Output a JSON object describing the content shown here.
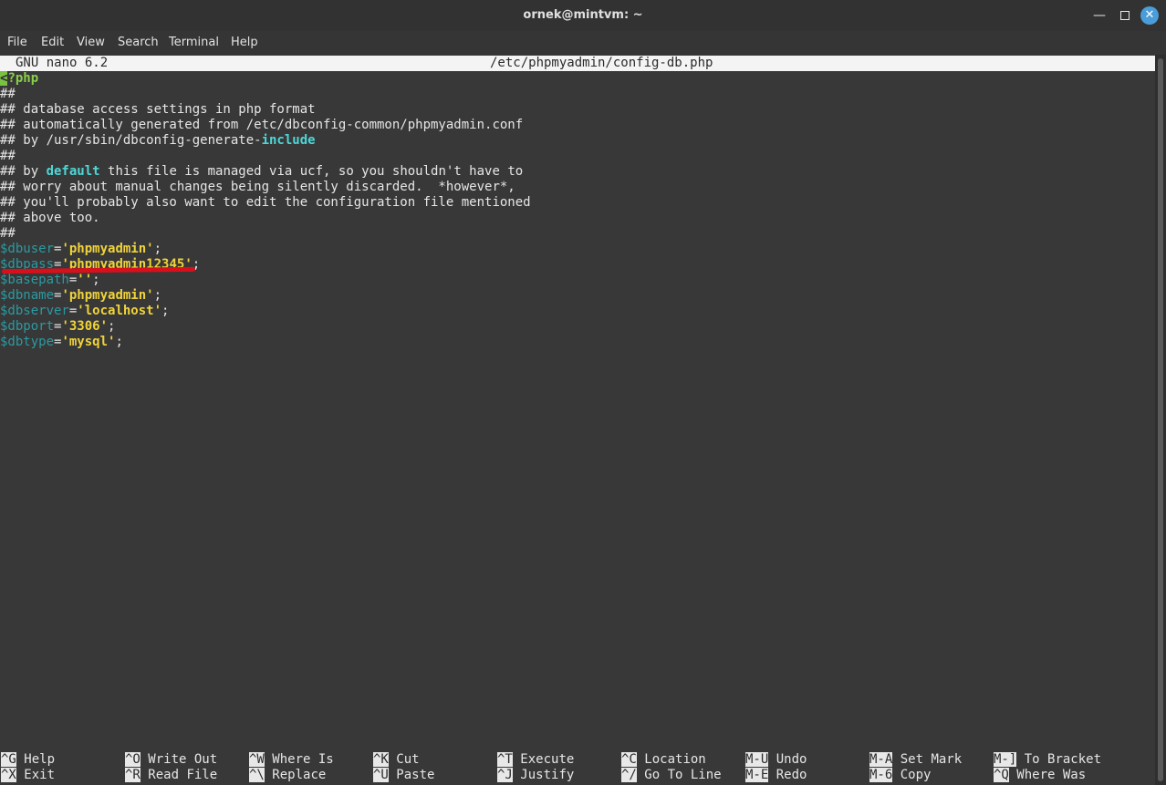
{
  "window": {
    "title": "ornek@mintvm: ~"
  },
  "menu": [
    "File",
    "Edit",
    "View",
    "Search",
    "Terminal",
    "Help"
  ],
  "nano": {
    "version": "GNU nano 6.2",
    "filename": "/etc/phpmyadmin/config-db.php"
  },
  "code": {
    "open_tag_cursor": "<",
    "open_tag_rest": "?php",
    "c1": "##",
    "c2": "## database access settings in php format",
    "c3": "## automatically generated from /etc/dbconfig-common/phpmyadmin.conf",
    "c4_pre": "## by /usr/sbin/dbconfig-generate-",
    "c4_kw": "include",
    "c5": "##",
    "c6_pre": "## by ",
    "c6_kw": "default",
    "c6_post": " this file is managed via ucf, so you shouldn't have to",
    "c7": "## worry about manual changes being silently discarded.  *however*,",
    "c8": "## you'll probably also want to edit the configuration file mentioned",
    "c9": "## above too.",
    "c10": "##",
    "vars": [
      {
        "name": "$dbuser",
        "value": "'phpmyadmin'"
      },
      {
        "name": "$dbpass",
        "value": "'phpmyadmin12345'"
      },
      {
        "name": "$basepath",
        "value": "''"
      },
      {
        "name": "$dbname",
        "value": "'phpmyadmin'"
      },
      {
        "name": "$dbserver",
        "value": "'localhost'"
      },
      {
        "name": "$dbport",
        "value": "'3306'"
      },
      {
        "name": "$dbtype",
        "value": "'mysql'"
      }
    ],
    "eq": "=",
    "semi": ";"
  },
  "shortcuts": {
    "row1": [
      {
        "key": "^G",
        "label": "Help"
      },
      {
        "key": "^O",
        "label": "Write Out"
      },
      {
        "key": "^W",
        "label": "Where Is"
      },
      {
        "key": "^K",
        "label": "Cut"
      },
      {
        "key": "^T",
        "label": "Execute"
      },
      {
        "key": "^C",
        "label": "Location"
      },
      {
        "key": "M-U",
        "label": "Undo"
      },
      {
        "key": "M-A",
        "label": "Set Mark"
      },
      {
        "key": "M-]",
        "label": "To Bracket"
      }
    ],
    "row2": [
      {
        "key": "^X",
        "label": "Exit"
      },
      {
        "key": "^R",
        "label": "Read File"
      },
      {
        "key": "^\\",
        "label": "Replace"
      },
      {
        "key": "^U",
        "label": "Paste"
      },
      {
        "key": "^J",
        "label": "Justify"
      },
      {
        "key": "^/",
        "label": "Go To Line"
      },
      {
        "key": "M-E",
        "label": "Redo"
      },
      {
        "key": "M-6",
        "label": "Copy"
      },
      {
        "key": "^Q",
        "label": "Where Was"
      }
    ]
  },
  "colors": {
    "header_bg": "#f4f4f4",
    "keyword": "#4fd6d6",
    "variable": "#2a9aa2",
    "string": "#f0d33a",
    "php_tag": "#8ad04a",
    "annotation": "#d9101b"
  }
}
